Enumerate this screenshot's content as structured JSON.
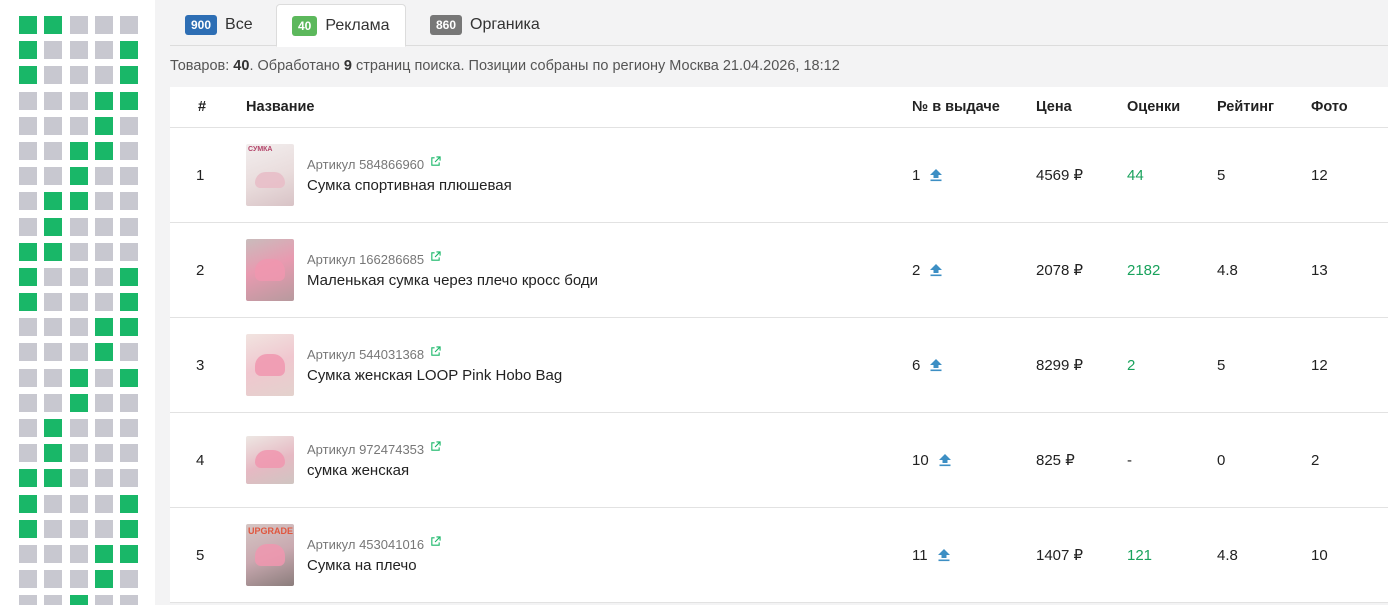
{
  "grid": [
    [
      1,
      1,
      0,
      0,
      0
    ],
    [
      1,
      0,
      0,
      0,
      1
    ],
    [
      1,
      0,
      0,
      0,
      1
    ],
    [
      0,
      0,
      0,
      1,
      1
    ],
    [
      0,
      0,
      0,
      1,
      0
    ],
    [
      0,
      0,
      1,
      1,
      0
    ],
    [
      0,
      0,
      1,
      0,
      0
    ],
    [
      0,
      1,
      1,
      0,
      0
    ],
    [
      0,
      1,
      0,
      0,
      0
    ],
    [
      1,
      1,
      0,
      0,
      0
    ],
    [
      1,
      0,
      0,
      0,
      1
    ],
    [
      1,
      0,
      0,
      0,
      1
    ],
    [
      0,
      0,
      0,
      1,
      1
    ],
    [
      0,
      0,
      0,
      1,
      0
    ],
    [
      0,
      0,
      1,
      0,
      1
    ],
    [
      0,
      0,
      1,
      0,
      0
    ],
    [
      0,
      1,
      0,
      0,
      0
    ],
    [
      0,
      1,
      0,
      0,
      0
    ],
    [
      1,
      1,
      0,
      0,
      0
    ],
    [
      1,
      0,
      0,
      0,
      1
    ],
    [
      1,
      0,
      0,
      0,
      1
    ],
    [
      0,
      0,
      0,
      1,
      1
    ],
    [
      0,
      0,
      0,
      1,
      0
    ],
    [
      0,
      0,
      1,
      0,
      0
    ]
  ],
  "colors": {
    "grid_on": "#19b768",
    "grid_off": "#c8c8d0",
    "accent_green": "#19a25c",
    "badge_blue": "#2d6eb4",
    "badge_green": "#5cb85c",
    "badge_gray": "#777777"
  },
  "tabs": [
    {
      "count": "900",
      "label": "Все"
    },
    {
      "count": "40",
      "label": "Реклама"
    },
    {
      "count": "860",
      "label": "Органика"
    }
  ],
  "summary": {
    "prefix": "Товаров: ",
    "items_count": "40",
    "middle": ". Обработано ",
    "pages_count": "9",
    "suffix": " страниц поиска. Позиции собраны по региону Москва 21.04.2026, 18:12"
  },
  "table": {
    "headers": {
      "num": "#",
      "name": "Название",
      "pos": "№ в выдаче",
      "price": "Цена",
      "reviews": "Оценки",
      "rating": "Рейтинг",
      "photos": "Фото"
    },
    "rows": [
      {
        "num": "1",
        "sku": "Артикул 584866960",
        "name": "Сумка спортивная плюшевая",
        "thumb_label": "СУМКА",
        "pos": "1",
        "price": "4569 ₽",
        "reviews": "44",
        "rating": "5",
        "photos": "12"
      },
      {
        "num": "2",
        "sku": "Артикул 166286685",
        "name": "Маленькая сумка через плечо кросс боди",
        "thumb_label": "",
        "pos": "2",
        "price": "2078 ₽",
        "reviews": "2182",
        "rating": "4.8",
        "photos": "13"
      },
      {
        "num": "3",
        "sku": "Артикул 544031368",
        "name": "Сумка женская LOOP Pink Hobo Bag",
        "thumb_label": "",
        "pos": "6",
        "price": "8299 ₽",
        "reviews": "2",
        "rating": "5",
        "photos": "12"
      },
      {
        "num": "4",
        "sku": "Артикул 972474353",
        "name": "сумка женская",
        "thumb_label": "",
        "pos": "10",
        "price": "825 ₽",
        "reviews": "-",
        "rating": "0",
        "photos": "2"
      },
      {
        "num": "5",
        "sku": "Артикул 453041016",
        "name": "Сумка на плечо",
        "thumb_label": "UPGRADE",
        "pos": "11",
        "price": "1407 ₽",
        "reviews": "121",
        "rating": "4.8",
        "photos": "10"
      }
    ]
  }
}
